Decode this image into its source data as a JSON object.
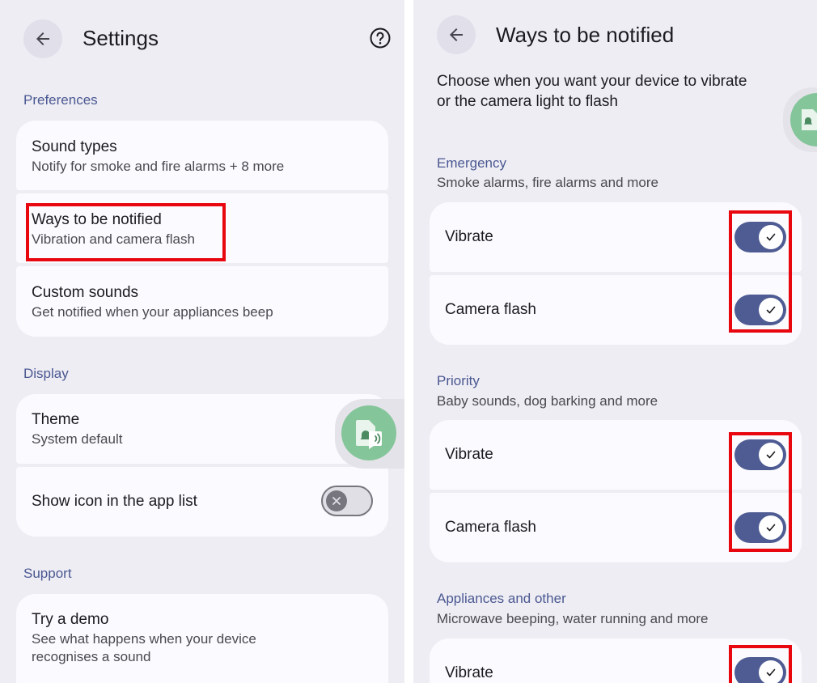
{
  "left": {
    "title": "Settings",
    "sections": {
      "preferences": "Preferences",
      "display": "Display",
      "support": "Support"
    },
    "items": {
      "sound_types": {
        "title": "Sound types",
        "subtitle": "Notify for smoke and fire alarms + 8 more"
      },
      "ways": {
        "title": "Ways to be notified",
        "subtitle": "Vibration and camera flash"
      },
      "custom": {
        "title": "Custom sounds",
        "subtitle": "Get notified when your appliances beep"
      },
      "theme": {
        "title": "Theme",
        "subtitle": "System default"
      },
      "show_icon": {
        "title": "Show icon in the app list",
        "state": "off"
      },
      "demo": {
        "title": "Try a demo",
        "subtitle_line1": "See what happens when your device",
        "subtitle_line2": "recognises a sound"
      }
    },
    "icons": {
      "back": "arrow-back-icon",
      "help": "help-circle-icon",
      "floating": "sound-notification-icon"
    }
  },
  "right": {
    "title": "Ways to be notified",
    "intro_line1": "Choose when you want your device to vibrate",
    "intro_line2": "or the camera light to flash",
    "groups": {
      "emergency": {
        "label": "Emergency",
        "sub": "Smoke alarms, fire alarms and more",
        "vibrate": "Vibrate",
        "flash": "Camera flash"
      },
      "priority": {
        "label": "Priority",
        "sub": "Baby sounds, dog barking and more",
        "vibrate": "Vibrate",
        "flash": "Camera flash"
      },
      "appliances": {
        "label": "Appliances and other",
        "sub": "Microwave beeping, water running and more",
        "vibrate": "Vibrate"
      }
    },
    "toggles_state": "on"
  },
  "colors": {
    "accent": "#4e5c93",
    "highlight": "#e8060f",
    "background": "#eeedf4",
    "card": "#fbfafe",
    "bubble": "#85c59a"
  }
}
